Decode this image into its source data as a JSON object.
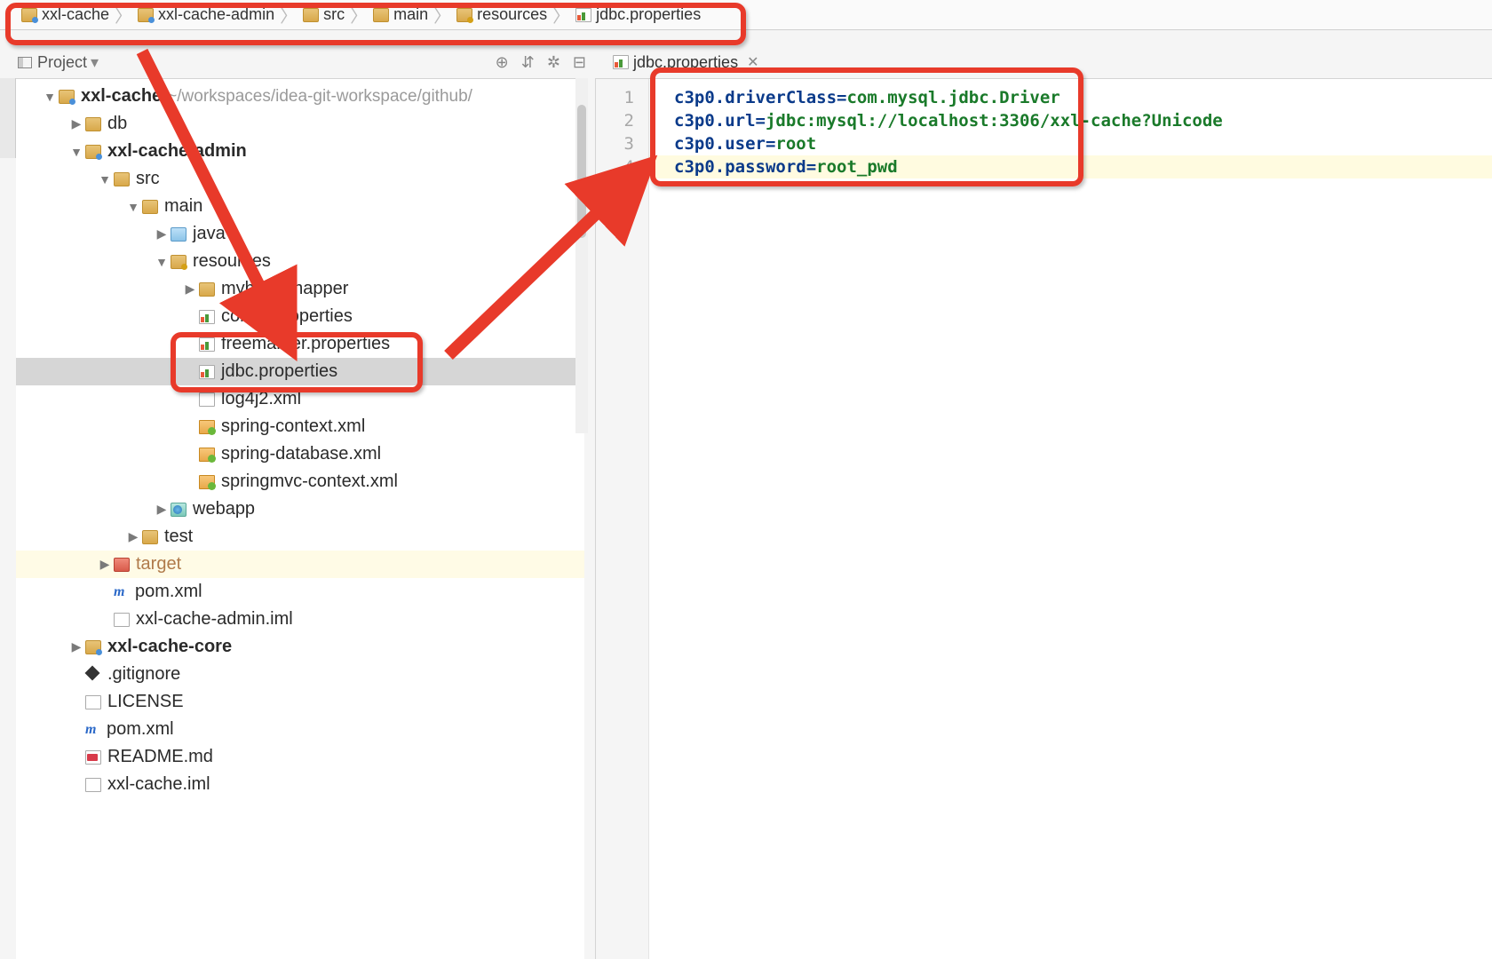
{
  "breadcrumbs": [
    {
      "icon": "folder blue-dot",
      "label": "xxl-cache"
    },
    {
      "icon": "folder blue-dot",
      "label": "xxl-cache-admin"
    },
    {
      "icon": "folder",
      "label": "src"
    },
    {
      "icon": "folder",
      "label": "main"
    },
    {
      "icon": "folder gold-dot",
      "label": "resources"
    },
    {
      "icon": "props",
      "label": "jdbc.properties"
    }
  ],
  "panel": {
    "title": "Project",
    "toolbar_icons": [
      "target-icon",
      "collapse-icon",
      "gear-icon",
      "hide-icon"
    ]
  },
  "project_root": {
    "name": "xxl-cache",
    "path": "~/workspaces/idea-git-workspace/github/"
  },
  "tree": [
    {
      "d": 0,
      "arrow": "▼",
      "icon": "folder blue-dot",
      "label": "xxl-cache",
      "bold": true,
      "suffix": "~/workspaces/idea-git-workspace/github/"
    },
    {
      "d": 1,
      "arrow": "▶",
      "icon": "folder",
      "label": "db"
    },
    {
      "d": 1,
      "arrow": "▼",
      "icon": "folder blue-dot",
      "label": "xxl-cache-admin",
      "bold": true
    },
    {
      "d": 2,
      "arrow": "▼",
      "icon": "folder",
      "label": "src"
    },
    {
      "d": 3,
      "arrow": "▼",
      "icon": "folder",
      "label": "main"
    },
    {
      "d": 4,
      "arrow": "▶",
      "icon": "folder java-blue",
      "label": "java"
    },
    {
      "d": 4,
      "arrow": "▼",
      "icon": "folder gold-dot",
      "label": "resources"
    },
    {
      "d": 5,
      "arrow": "▶",
      "icon": "folder",
      "label": "mybatis-mapper"
    },
    {
      "d": 5,
      "arrow": "",
      "icon": "file props",
      "label": "config.properties"
    },
    {
      "d": 5,
      "arrow": "",
      "icon": "file props",
      "label": "freemarker.properties"
    },
    {
      "d": 5,
      "arrow": "",
      "icon": "file props",
      "label": "jdbc.properties",
      "selected": true
    },
    {
      "d": 5,
      "arrow": "",
      "icon": "file xml",
      "label": "log4j2.xml"
    },
    {
      "d": 5,
      "arrow": "",
      "icon": "file spring",
      "label": "spring-context.xml"
    },
    {
      "d": 5,
      "arrow": "",
      "icon": "file spring",
      "label": "spring-database.xml"
    },
    {
      "d": 5,
      "arrow": "",
      "icon": "file spring",
      "label": "springmvc-context.xml"
    },
    {
      "d": 4,
      "arrow": "▶",
      "icon": "folder teal web",
      "label": "webapp"
    },
    {
      "d": 3,
      "arrow": "▶",
      "icon": "folder",
      "label": "test"
    },
    {
      "d": 2,
      "arrow": "▶",
      "icon": "folder red",
      "label": "target",
      "excluded": true
    },
    {
      "d": 2,
      "arrow": "",
      "icon": "maven",
      "label": "pom.xml"
    },
    {
      "d": 2,
      "arrow": "",
      "icon": "file",
      "label": "xxl-cache-admin.iml"
    },
    {
      "d": 1,
      "arrow": "▶",
      "icon": "folder blue-dot",
      "label": "xxl-cache-core",
      "bold": true
    },
    {
      "d": 1,
      "arrow": "",
      "icon": "file diamond",
      "label": ".gitignore"
    },
    {
      "d": 1,
      "arrow": "",
      "icon": "file",
      "label": "LICENSE"
    },
    {
      "d": 1,
      "arrow": "",
      "icon": "maven",
      "label": "pom.xml"
    },
    {
      "d": 1,
      "arrow": "",
      "icon": "file md",
      "label": "README.md"
    },
    {
      "d": 1,
      "arrow": "",
      "icon": "file",
      "label": "xxl-cache.iml"
    }
  ],
  "editor_tab": {
    "label": "jdbc.properties"
  },
  "editor_lines": [
    {
      "n": 1,
      "key": "c3p0.driverClass",
      "val": "com.mysql.jdbc.Driver"
    },
    {
      "n": 2,
      "key": "c3p0.url",
      "val": "jdbc:mysql://localhost:3306/xxl-cache?Unicode"
    },
    {
      "n": 3,
      "key": "c3p0.user",
      "val": "root"
    },
    {
      "n": 4,
      "key": "c3p0.password",
      "val": "root_pwd",
      "hl": true
    }
  ]
}
